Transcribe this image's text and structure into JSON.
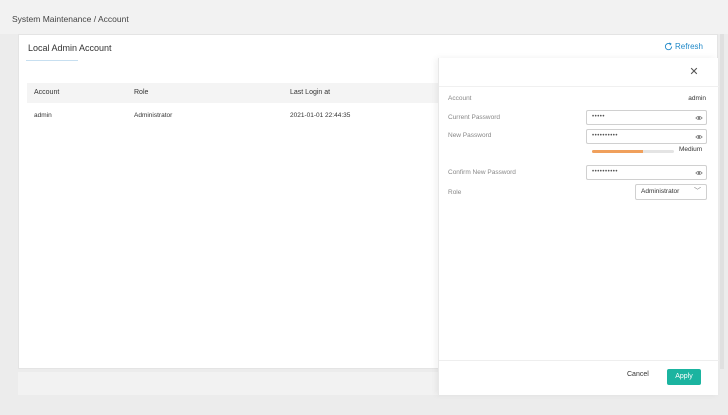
{
  "breadcrumb": "System Maintenance / Account",
  "card": {
    "title": "Local Admin Account",
    "refresh_label": "Refresh"
  },
  "table": {
    "headers": [
      "Account",
      "Role",
      "Last Login at"
    ],
    "rows": [
      [
        "admin",
        "Administrator",
        "2021-01-01 22:44:35"
      ]
    ]
  },
  "panel": {
    "account_label": "Account",
    "account_value": "admin",
    "current_password_label": "Current Password",
    "current_password_value": "•••••",
    "new_password_label": "New Password",
    "new_password_value": "••••••••••",
    "strength_label": "Medium",
    "strength_level": 0.62,
    "strength_color": "#f0a05c",
    "confirm_password_label": "Confirm New Password",
    "confirm_password_value": "••••••••••",
    "role_label": "Role",
    "role_value": "Administrator",
    "cancel_label": "Cancel",
    "apply_label": "Apply",
    "apply_color": "#1bb4a0"
  },
  "icons": {
    "refresh": "refresh-icon",
    "close": "close-icon",
    "eye": "eye-icon",
    "chevron": "chevron-down-icon"
  }
}
